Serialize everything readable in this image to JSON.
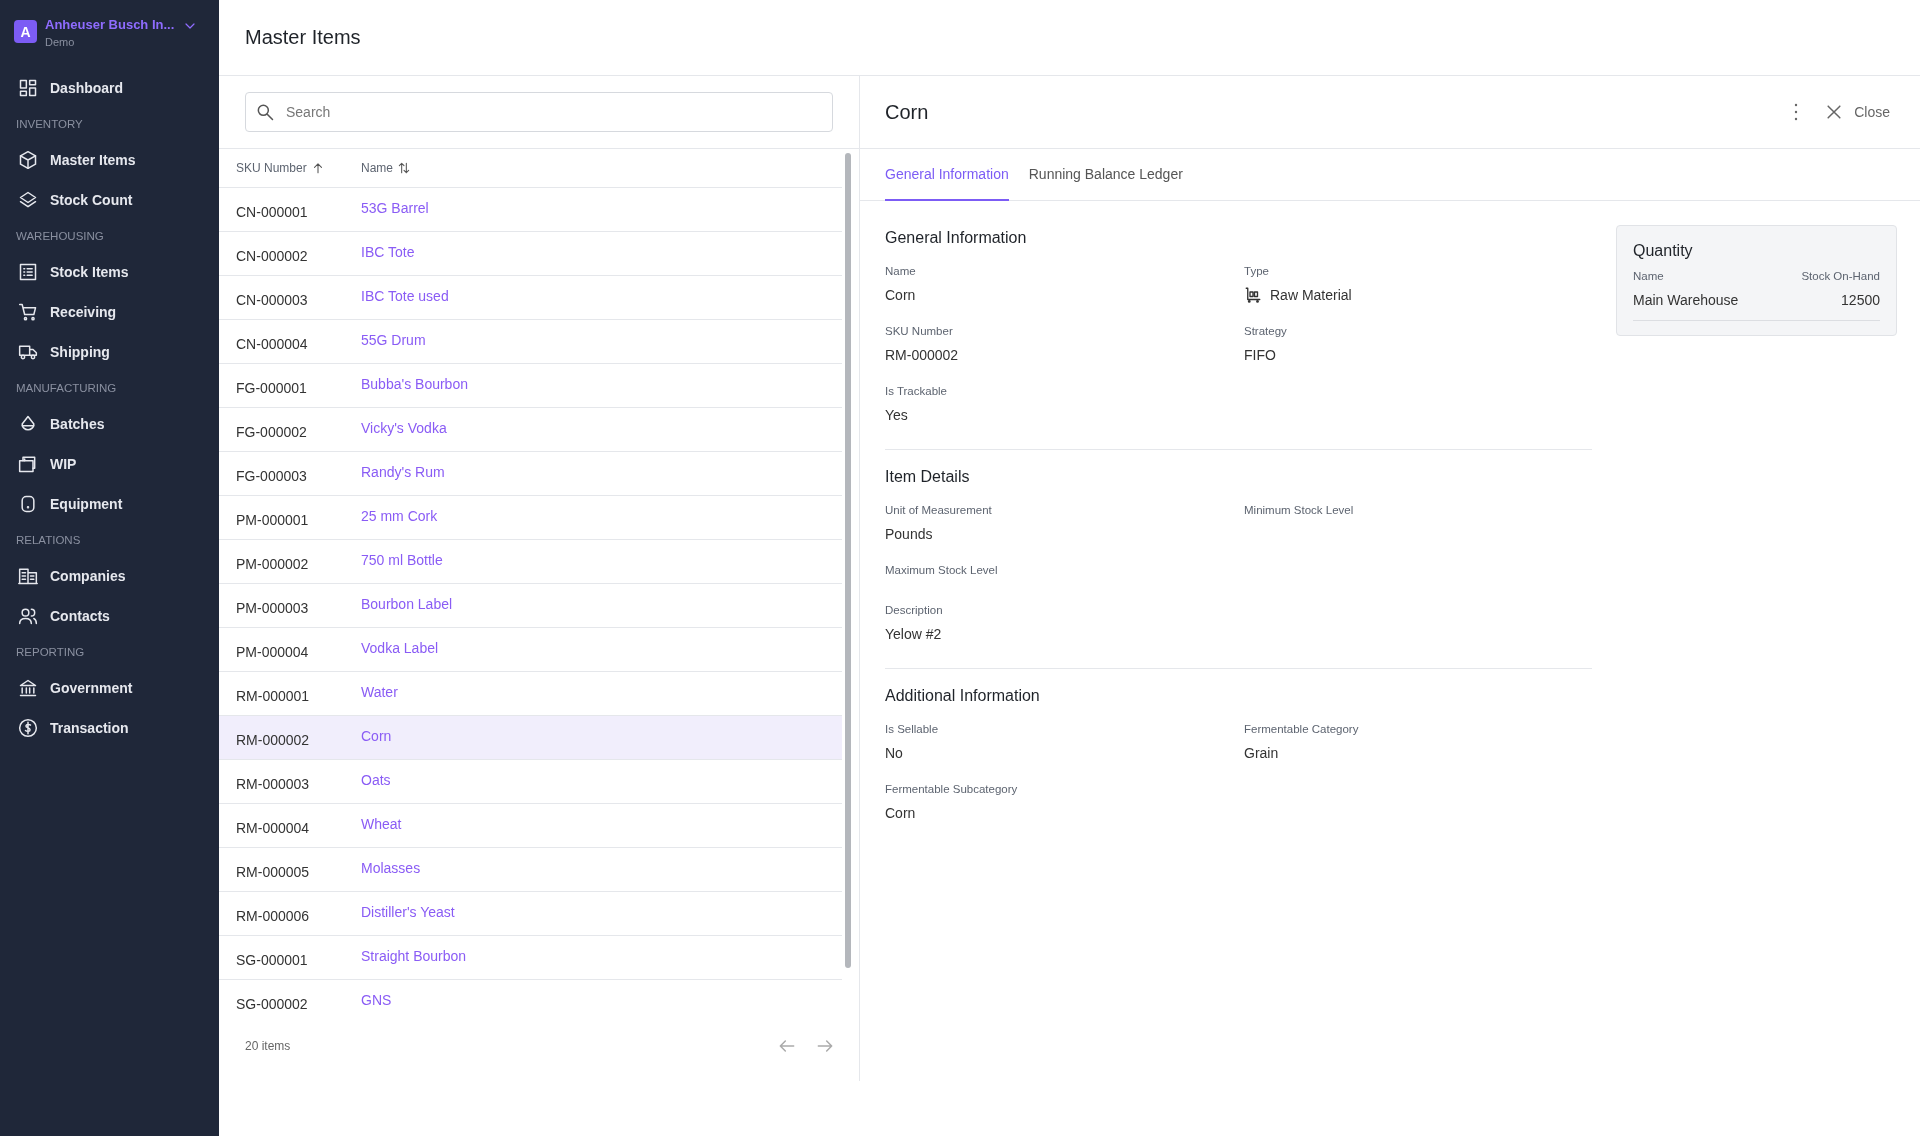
{
  "sidebar": {
    "org": {
      "initial": "A",
      "name": "Anheuser Busch In...",
      "subtitle": "Demo"
    },
    "sections": [
      {
        "items": [
          {
            "label": "Dashboard"
          }
        ]
      },
      {
        "heading": "INVENTORY",
        "items": [
          {
            "label": "Master Items"
          },
          {
            "label": "Stock Count"
          }
        ]
      },
      {
        "heading": "WAREHOUSING",
        "items": [
          {
            "label": "Stock Items"
          },
          {
            "label": "Receiving"
          },
          {
            "label": "Shipping"
          }
        ]
      },
      {
        "heading": "MANUFACTURING",
        "items": [
          {
            "label": "Batches"
          },
          {
            "label": "WIP"
          },
          {
            "label": "Equipment"
          }
        ]
      },
      {
        "heading": "RELATIONS",
        "items": [
          {
            "label": "Companies"
          },
          {
            "label": "Contacts"
          }
        ]
      },
      {
        "heading": "REPORTING",
        "items": [
          {
            "label": "Government"
          },
          {
            "label": "Transaction"
          }
        ]
      }
    ]
  },
  "page": {
    "title": "Master Items"
  },
  "search": {
    "placeholder": "Search"
  },
  "table": {
    "columns": [
      {
        "label": "SKU Number",
        "sorted": true
      },
      {
        "label": "Name",
        "sorted": false
      }
    ],
    "rows": [
      {
        "sku": "CN-000001",
        "name": "53G Barrel",
        "selected": false
      },
      {
        "sku": "CN-000002",
        "name": "IBC Tote",
        "selected": false
      },
      {
        "sku": "CN-000003",
        "name": "IBC Tote used",
        "selected": false
      },
      {
        "sku": "CN-000004",
        "name": "55G Drum",
        "selected": false
      },
      {
        "sku": "FG-000001",
        "name": "Bubba's Bourbon",
        "selected": false
      },
      {
        "sku": "FG-000002",
        "name": "Vicky's Vodka",
        "selected": false
      },
      {
        "sku": "FG-000003",
        "name": "Randy's Rum",
        "selected": false
      },
      {
        "sku": "PM-000001",
        "name": "25 mm Cork",
        "selected": false
      },
      {
        "sku": "PM-000002",
        "name": "750 ml Bottle",
        "selected": false
      },
      {
        "sku": "PM-000003",
        "name": "Bourbon Label",
        "selected": false
      },
      {
        "sku": "PM-000004",
        "name": "Vodka Label",
        "selected": false
      },
      {
        "sku": "RM-000001",
        "name": "Water",
        "selected": false
      },
      {
        "sku": "RM-000002",
        "name": "Corn",
        "selected": true
      },
      {
        "sku": "RM-000003",
        "name": "Oats",
        "selected": false
      },
      {
        "sku": "RM-000004",
        "name": "Wheat",
        "selected": false
      },
      {
        "sku": "RM-000005",
        "name": "Molasses",
        "selected": false
      },
      {
        "sku": "RM-000006",
        "name": "Distiller's Yeast",
        "selected": false
      },
      {
        "sku": "SG-000001",
        "name": "Straight Bourbon",
        "selected": false
      },
      {
        "sku": "SG-000002",
        "name": "GNS",
        "selected": false
      }
    ],
    "footer": "20 items"
  },
  "detail": {
    "title": "Corn",
    "close_label": "Close",
    "tabs": [
      {
        "label": "General Information",
        "selected": true
      },
      {
        "label": "Running Balance Ledger",
        "selected": false
      }
    ],
    "sections": [
      {
        "title": "General Information",
        "fields": [
          {
            "label": "Name",
            "value": "Corn"
          },
          {
            "label": "Type",
            "value": "Raw Material",
            "kind": "icon"
          },
          {
            "label": "SKU Number",
            "value": "RM-000002"
          },
          {
            "label": "Strategy",
            "value": "FIFO"
          },
          {
            "label": "Is Trackable",
            "value": "Yes"
          }
        ]
      },
      {
        "title": "Item Details",
        "fields": [
          {
            "label": "Unit of Measurement",
            "value": "Pounds"
          },
          {
            "label": "Minimum Stock Level"
          },
          {
            "label": "Maximum Stock Level"
          },
          {
            "label": "Description",
            "value": "Yelow #2",
            "kind": "wide"
          }
        ]
      },
      {
        "title": "Additional Information",
        "fields": [
          {
            "label": "Is Sellable",
            "value": "No"
          },
          {
            "label": "Fermentable Category",
            "value": "Grain"
          },
          {
            "label": "Fermentable Subcategory",
            "value": "Corn"
          }
        ]
      }
    ],
    "quantity": {
      "title": "Quantity",
      "columns": [
        "Name",
        "Stock On-Hand"
      ],
      "rows": [
        {
          "name": "Main Warehouse",
          "stock": "12500"
        }
      ]
    }
  }
}
